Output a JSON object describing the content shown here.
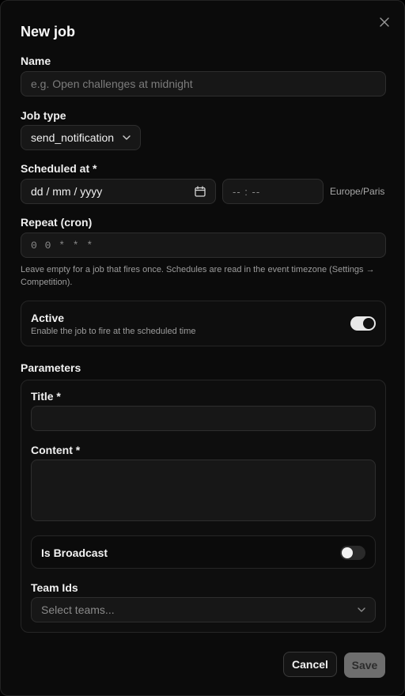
{
  "dialog": {
    "title": "New job",
    "close_icon": "close-icon"
  },
  "form": {
    "name": {
      "label": "Name",
      "value": "",
      "placeholder": "e.g. Open challenges at midnight"
    },
    "job_type": {
      "label": "Job type",
      "value": "send_notification"
    },
    "scheduled_at": {
      "label": "Scheduled at *",
      "date_placeholder": "dd / mm / yyyy",
      "time_placeholder": "-- : --",
      "timezone": "Europe/Paris"
    },
    "repeat": {
      "label": "Repeat (cron)",
      "value": "",
      "placeholder": "0 0 * * *",
      "help": "Leave empty for a job that fires once. Schedules are read in the event timezone (Settings → Competition)."
    },
    "active": {
      "label": "Active",
      "description": "Enable the job to fire at the scheduled time",
      "enabled": true
    }
  },
  "parameters": {
    "heading": "Parameters",
    "title_field": {
      "label": "Title *",
      "value": ""
    },
    "content_field": {
      "label": "Content *",
      "value": ""
    },
    "is_broadcast": {
      "label": "Is Broadcast",
      "enabled": false
    },
    "team_ids": {
      "label": "Team Ids",
      "placeholder": "Select teams..."
    }
  },
  "footer": {
    "cancel_label": "Cancel",
    "save_label": "Save"
  }
}
